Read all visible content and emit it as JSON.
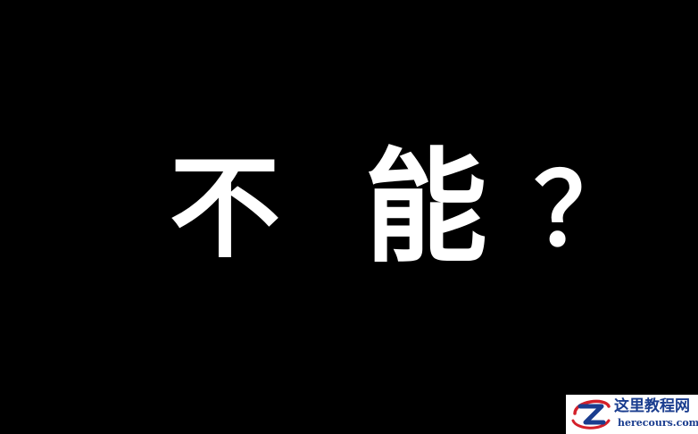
{
  "headline": {
    "chars": [
      "不",
      "能",
      "？"
    ]
  },
  "watermark": {
    "title": "这里教程网",
    "url": "herecours.com"
  },
  "colors": {
    "background": "#000000",
    "text": "#ffffff",
    "watermark_blue": "#1a3d8f",
    "watermark_red": "#d4202a"
  }
}
